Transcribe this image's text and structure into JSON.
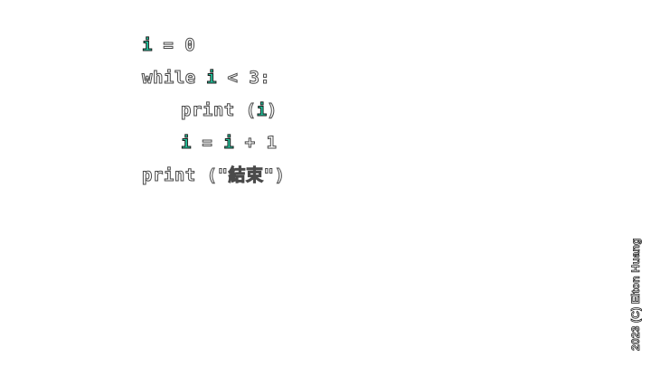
{
  "code": {
    "line1": {
      "var": "i",
      "rest": " = 0"
    },
    "line2": {
      "kw": "while",
      "var": "i",
      "rest": " < 3:"
    },
    "line3": {
      "fn": "print (",
      "var": "i",
      "close": ")"
    },
    "line4": {
      "var1": "i",
      "eq": " = ",
      "var2": "i",
      "rest": " + 1"
    },
    "line5": {
      "text": "print (\"結束\")"
    }
  },
  "copyright": "2023 (C) Elton Huang"
}
